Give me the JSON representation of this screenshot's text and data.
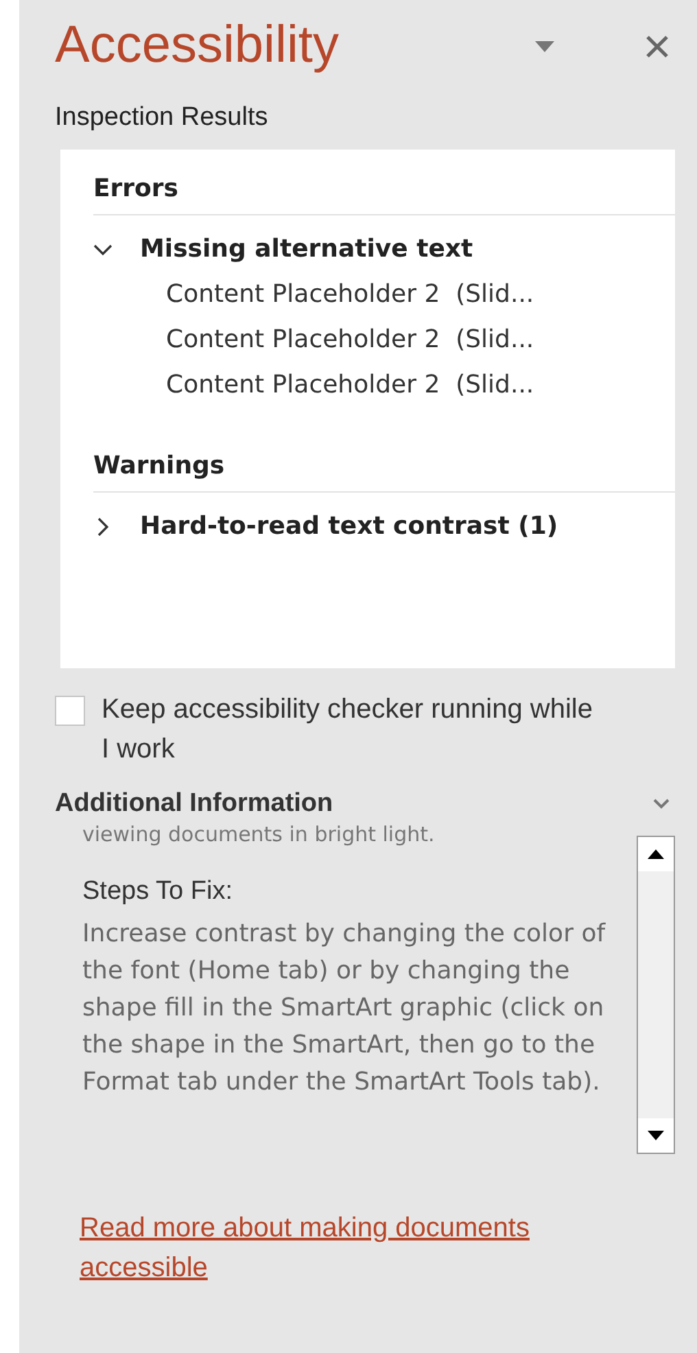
{
  "pane": {
    "title": "Accessibility",
    "subtitle": "Inspection Results"
  },
  "sections": [
    {
      "heading": "Errors",
      "groups": [
        {
          "label": "Missing alternative text",
          "expanded": true,
          "items": [
            "Content Placeholder 2  (Slid...",
            "Content Placeholder 2  (Slid...",
            "Content Placeholder 2  (Slid..."
          ]
        }
      ]
    },
    {
      "heading": "Warnings",
      "groups": [
        {
          "label": "Hard-to-read text contrast (1)",
          "expanded": false
        }
      ]
    }
  ],
  "keep_running": {
    "label": "Keep accessibility checker running while I work",
    "checked": false
  },
  "additional_info": {
    "heading": "Additional Information",
    "expanded": true,
    "clipped_line": "viewing documents in bright light.",
    "steps_heading": "Steps To Fix:",
    "steps_text": "Increase contrast by changing the color of the font (Home tab) or by changing the shape fill in the SmartArt graphic (click on the shape in the SmartArt, then go to the Format tab under the SmartArt Tools tab)."
  },
  "link": "Read more about making documents accessible"
}
